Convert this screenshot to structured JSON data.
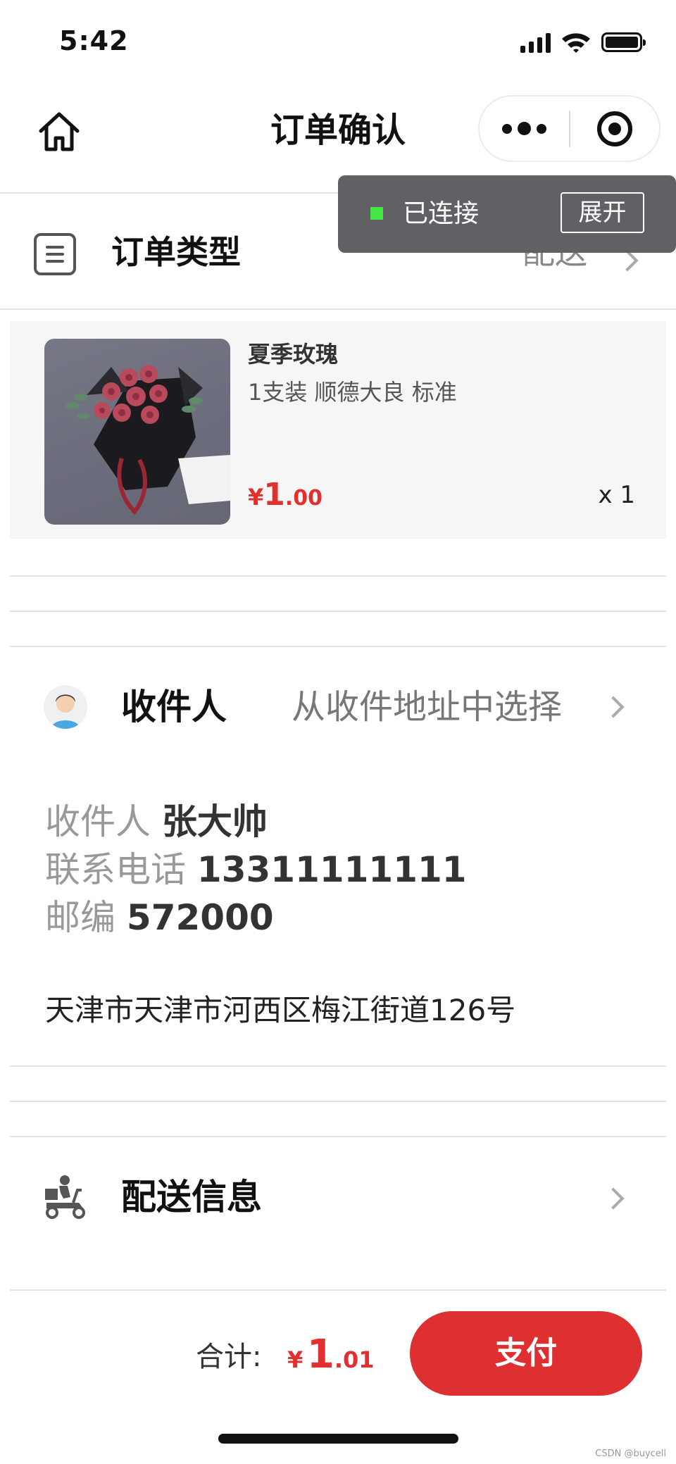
{
  "status_bar": {
    "time": "5:42"
  },
  "nav": {
    "title": "订单确认"
  },
  "banner": {
    "status": "已连接",
    "expand_label": "展开"
  },
  "order_type": {
    "label": "订单类型",
    "value": "配送"
  },
  "product": {
    "name": "夏季玫瑰",
    "spec": "1支装 顺德大良 标准",
    "price_symbol": "¥",
    "price_int": "1",
    "price_dec": ".00",
    "quantity": "x 1"
  },
  "recipient": {
    "label": "收件人",
    "pick_label": "从收件地址中选择",
    "name_key": "收件人",
    "name": "张大帅",
    "phone_key": "联系电话",
    "phone": "13311111111",
    "zip_key": "邮编",
    "zip": "572000",
    "address": "天津市天津市河西区梅江街道126号"
  },
  "delivery": {
    "label": "配送信息"
  },
  "footer": {
    "total_label": "合计:",
    "total_symbol": "¥",
    "total_int": "1",
    "total_dec": ".01",
    "pay_label": "支付"
  },
  "watermark": "CSDN @buycell",
  "colors": {
    "accent": "#de3030",
    "banner_bg": "#606065",
    "connected_dot": "#43e844"
  }
}
